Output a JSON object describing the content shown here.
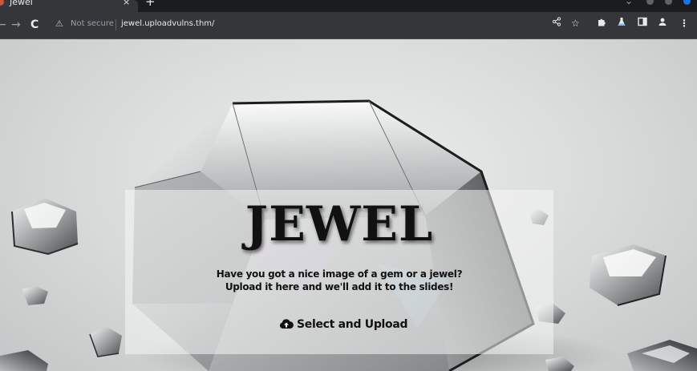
{
  "browser": {
    "tab_title": "Jewel",
    "tab_close": "×",
    "new_tab": "+",
    "nav": {
      "back": "←",
      "forward": "→",
      "reload": "C"
    },
    "security_label": "Not secure",
    "url": "jewel.uploadvulns.thm/",
    "icons": [
      "share-icon",
      "star-icon",
      "extensions-icon",
      "labs-icon",
      "side-panel-icon",
      "profile-icon",
      "menu-icon"
    ],
    "colors": {
      "frame": "#1b1c1f",
      "toolbar": "#35363a",
      "profile_dot": "#1a73e8"
    }
  },
  "page": {
    "logo_text": "JEWEL",
    "message_line1": "Have you got a nice image of a gem or a jewel?",
    "message_line2": "Upload it here and we'll add it to the slides!",
    "upload_label": "Select and Upload",
    "upload_icon": "cloud-upload-icon"
  }
}
